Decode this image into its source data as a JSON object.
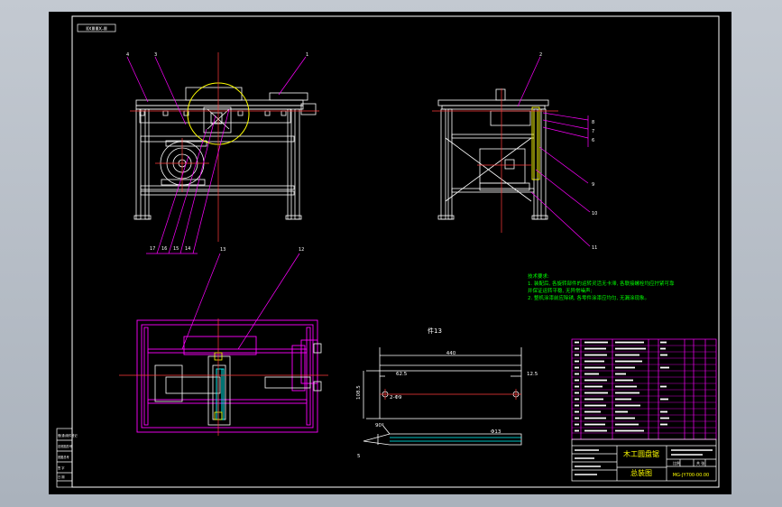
{
  "drawing": {
    "view_tag": "ⅡⅩⅢⅢⅩ-Ⅲ",
    "part_view_title": "件13",
    "dims": {
      "length_total": "440",
      "left_offset": "62.5",
      "right_offset": "12.5",
      "height": "108.5",
      "holes": "2-Φ9",
      "diameter": "Φ13",
      "angle": "90°",
      "thickness": "5"
    },
    "balloons": {
      "front_top": [
        "4",
        "3",
        "1"
      ],
      "front_bottom": [
        "17",
        "16",
        "15",
        "14"
      ],
      "side_top": [
        "2"
      ],
      "side_right": [
        "8",
        "7",
        "6",
        "9",
        "10",
        "11"
      ],
      "plan_top": [
        "13",
        "12"
      ]
    },
    "notes": {
      "title": "技术要求:",
      "line1": "1. 装配后, 各旋转部件的运转灵活无卡滞, 各联接螺栓均应拧紧可靠",
      "line2": "   并保证运转平稳, 无异常噪声;",
      "line3": "2. 整机涂漆前应除锈, 各零件涂漆应均匀, 无漏涂现象。"
    },
    "title_block": {
      "company": "木工圆盘锯",
      "drawing_name": "总装图",
      "drawing_no": "MG-JY700-00.00",
      "scale_label": "比例",
      "sheet_label": "共 张"
    },
    "revision_block": {
      "rows": [
        "借(通)用件登记",
        "旧底图总号",
        "底图总号",
        "签 字",
        "日 期"
      ]
    }
  }
}
